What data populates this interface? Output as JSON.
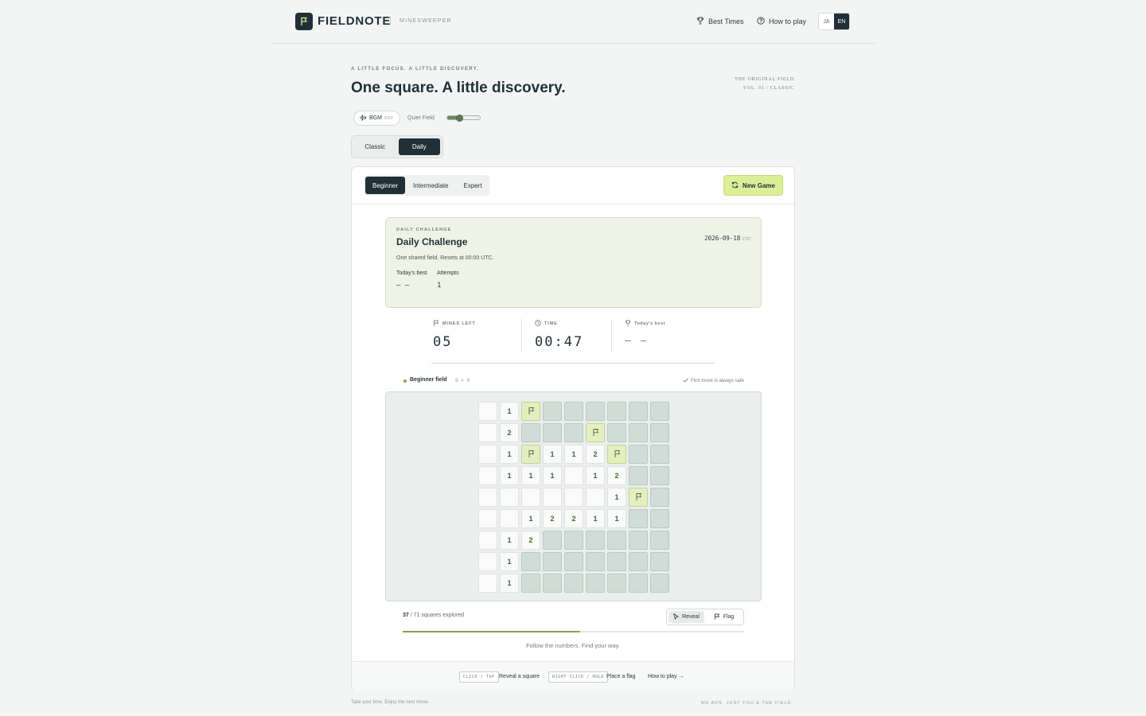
{
  "header": {
    "brand": "FIELDNOTE",
    "separator": "|",
    "subtitle": "MINESWEEPER",
    "nav": {
      "best_times": "Best Times",
      "how_to_play": "How to play"
    },
    "lang": {
      "ja": "JA",
      "en": "EN",
      "selected": "EN"
    }
  },
  "hero": {
    "tagline": "A LITTLE FOCUS. A LITTLE DISCOVERY.",
    "headline": "One square. A little discovery.",
    "edition_line1": "THE ORIGINAL FIELD",
    "edition_line2": "VOL. 01 / CLASSIC"
  },
  "audio": {
    "bgm_label": "BGM",
    "bgm_state": "OFF",
    "track_label": "Quiet Field",
    "volume": 0.38
  },
  "mode_tabs": {
    "classic": "Classic",
    "daily": "Daily",
    "selected": "Daily"
  },
  "difficulty": {
    "beginner": "Beginner",
    "intermediate": "Intermediate",
    "expert": "Expert",
    "selected": "Beginner"
  },
  "new_game_label": "New Game",
  "daily": {
    "kicker": "DAILY CHALLENGE",
    "title": "Daily Challenge",
    "date": "2026-09-18",
    "date_suffix": "UTC",
    "description": "One shared field. Resets at 00:00 UTC.",
    "best_label": "Today's best",
    "best_value": "— —",
    "attempts_label": "Attempts",
    "attempts_value": "1"
  },
  "stats": {
    "mines_label": "MINES LEFT",
    "mines_value": "05",
    "time_label": "TIME",
    "time_value": "00:47",
    "best_label": "Today's best",
    "best_value": "— —"
  },
  "field": {
    "name": "Beginner field",
    "size": "9 × 9",
    "safe_note": "First move is always safe"
  },
  "board": [
    [
      "o",
      "1",
      "F",
      "h",
      "h",
      "h",
      "h",
      "h",
      "h"
    ],
    [
      "o",
      "2",
      "h",
      "h",
      "h",
      "F",
      "h",
      "h",
      "h"
    ],
    [
      "o",
      "1",
      "F",
      "1",
      "1",
      "2",
      "F",
      "h",
      "h"
    ],
    [
      "o",
      "1",
      "1",
      "1",
      "o",
      "1",
      "2",
      "h",
      "h"
    ],
    [
      "o",
      "o",
      "o",
      "o",
      "o",
      "o",
      "1",
      "F",
      "h"
    ],
    [
      "o",
      "o",
      "1",
      "2",
      "2",
      "1",
      "1",
      "h",
      "h"
    ],
    [
      "o",
      "1",
      "2",
      "h",
      "h",
      "h",
      "h",
      "h",
      "h"
    ],
    [
      "o",
      "1",
      "h",
      "h",
      "h",
      "h",
      "h",
      "h",
      "h"
    ],
    [
      "o",
      "1",
      "h",
      "h",
      "h",
      "h",
      "h",
      "h",
      "h"
    ]
  ],
  "progress": {
    "explored": "37",
    "total_text": "/ 71 squares explored",
    "fraction": 0.52
  },
  "tools": {
    "reveal": "Reveal",
    "flag": "Flag",
    "selected": "Reveal"
  },
  "hint": "Follow the numbers. Find your way.",
  "footer": {
    "kbd1": "CLICK / TAP",
    "kbd1_desc": "Reveal a square",
    "kbd2": "RIGHT CLICK / HOLD",
    "kbd2_desc": "Place a flag",
    "how_to_play": "How to play →"
  },
  "page_footer": {
    "left": "Take your time. Enjoy the next move.",
    "right": "NO ADS. JUST YOU & THE FIELD."
  }
}
